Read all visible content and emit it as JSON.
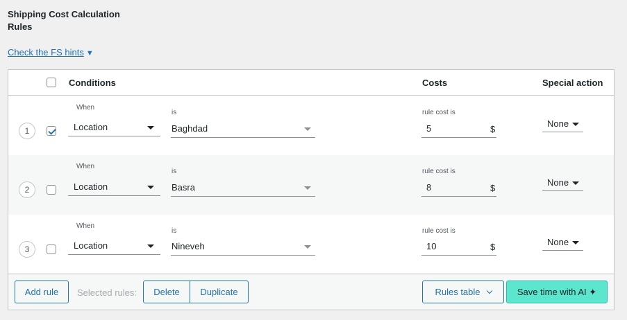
{
  "page": {
    "title": "Shipping Cost Calculation Rules",
    "hints_link": "Check the FS hints",
    "hints_arrow": "▼"
  },
  "table": {
    "headers": {
      "conditions": "Conditions",
      "costs": "Costs",
      "special_action": "Special action"
    },
    "rows": [
      {
        "number": "1",
        "checked": true,
        "when_label": "When",
        "condition": "Location",
        "is_label": "is",
        "value": "Baghdad",
        "cost_label": "rule cost is",
        "cost": "5",
        "currency": "$",
        "special": "None"
      },
      {
        "number": "2",
        "checked": false,
        "when_label": "When",
        "condition": "Location",
        "is_label": "is",
        "value": "Basra",
        "cost_label": "rule cost is",
        "cost": "8",
        "currency": "$",
        "special": "None"
      },
      {
        "number": "3",
        "checked": false,
        "when_label": "When",
        "condition": "Location",
        "is_label": "is",
        "value": "Nineveh",
        "cost_label": "rule cost is",
        "cost": "10",
        "currency": "$",
        "special": "None"
      }
    ]
  },
  "footer": {
    "add_rule": "Add rule",
    "selected_rules": "Selected rules:",
    "delete": "Delete",
    "duplicate": "Duplicate",
    "rules_table": "Rules table",
    "ai_button": "Save time with AI ✦"
  },
  "colors": {
    "accent": "#2271b1",
    "ai_button": "#5ce6cd"
  }
}
